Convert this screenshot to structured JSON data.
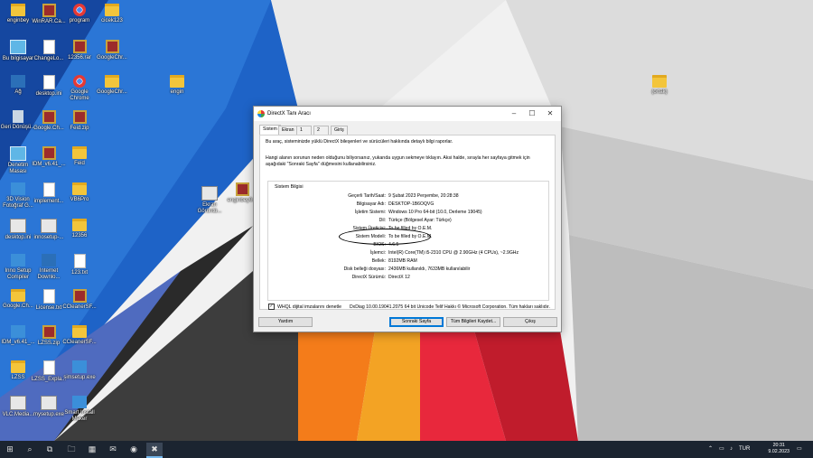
{
  "desktop": {
    "icons": [
      {
        "label": "enginbey",
        "type": "folder"
      },
      {
        "label": "WinRAR.Ca...",
        "type": "rar"
      },
      {
        "label": "program",
        "type": "chrome"
      },
      {
        "label": "cicek123",
        "type": "folder"
      },
      {
        "label": "Bu bilgisayar",
        "type": "pc"
      },
      {
        "label": "ChangeLo...",
        "type": "doc"
      },
      {
        "label": "12356.rar",
        "type": "rar"
      },
      {
        "label": "GoogleChr...",
        "type": "rar"
      },
      {
        "label": "Ağ",
        "type": "net"
      },
      {
        "label": "desktop.ini",
        "type": "doc"
      },
      {
        "label": "Google Chrome",
        "type": "chrome"
      },
      {
        "label": "GoogleChr...",
        "type": "folder"
      },
      {
        "label": "engin",
        "type": "folder"
      },
      {
        "label": "Geri Dönüşü...",
        "type": "trash"
      },
      {
        "label": "Google.Ch...",
        "type": "rar"
      },
      {
        "label": "Feid.zip",
        "type": "rar"
      },
      {
        "label": "Denetim Masası",
        "type": "pc"
      },
      {
        "label": "IDM_v6.41_...",
        "type": "rar"
      },
      {
        "label": "Feid",
        "type": "folder"
      },
      {
        "label": "3D Vision Fotoğraf G...",
        "type": "setup"
      },
      {
        "label": "implement...",
        "type": "doc"
      },
      {
        "label": "VB6Pro",
        "type": "folder"
      },
      {
        "label": "Ekran Görüntü...",
        "type": "exe"
      },
      {
        "label": "enginbey0...",
        "type": "rar"
      },
      {
        "label": "desktop.ini",
        "type": "exe"
      },
      {
        "label": "innosetup-...",
        "type": "exe"
      },
      {
        "label": "12356",
        "type": "folder"
      },
      {
        "label": "Inno Setup Compiler",
        "type": "setup"
      },
      {
        "label": "Internet Downlo...",
        "type": "net"
      },
      {
        "label": "123.txt",
        "type": "doc"
      },
      {
        "label": "Google.Ch...",
        "type": "folder"
      },
      {
        "label": "License.txt",
        "type": "doc"
      },
      {
        "label": "CCleanerSF...",
        "type": "rar"
      },
      {
        "label": "IDM_v6.41_...",
        "type": "setup"
      },
      {
        "label": "LZSS.zip",
        "type": "rar"
      },
      {
        "label": "CCleanerSF...",
        "type": "folder"
      },
      {
        "label": "LZSS",
        "type": "folder"
      },
      {
        "label": "LZSS_Expla...",
        "type": "doc"
      },
      {
        "label": "simsetup.exe",
        "type": "setup"
      },
      {
        "label": "VLC.Media...",
        "type": "exe"
      },
      {
        "label": "mysetup.exe",
        "type": "exe"
      },
      {
        "label": "Smart Install Maker",
        "type": "setup"
      },
      {
        "label": "(ortak)",
        "type": "folder"
      }
    ]
  },
  "dxdiag": {
    "title": "DirectX Tanı Aracı",
    "controls": {
      "minimize": "–",
      "maximize": "☐",
      "close": "✕"
    },
    "tabs": [
      "Sistem",
      "Ekran",
      "1 Ses",
      "2 Ses",
      "Giriş"
    ],
    "intro1": "Bu araç, sisteminizde yüklü DirectX bileşenleri ve sürücüleri hakkında detaylı bilgi raporlar.",
    "intro2": "Hangi alanın sorunun neden olduğunu biliyorsanız, yukarıda uygun sekmeye tıklayın. Aksi halde, sırayla her sayfaya gitmek için aşağıdaki \"Sonraki Sayfa\" düğmesini kullanabilirsiniz.",
    "group_title": "Sistem Bilgisi",
    "info": [
      {
        "k": "Geçerli Tarih/Saat:",
        "v": "9 Şubat 2023 Perşembe, 20:28:38"
      },
      {
        "k": "Bilgisayar Adı:",
        "v": "DESKTOP-1B6OQVG"
      },
      {
        "k": "İşletim Sistemi:",
        "v": "Windows 10 Pro 64-bit (10.0, Derleme 19045)"
      },
      {
        "k": "Dil:",
        "v": "Türkçe (Bölgesel Ayar: Türkçe)"
      },
      {
        "k": "Sistem Üreticisi:",
        "v": "To be filled by O.E.M."
      },
      {
        "k": "Sistem Modeli:",
        "v": "To be filled by O.E.M."
      },
      {
        "k": "BIOS:",
        "v": "4.6.5"
      },
      {
        "k": "İşlemci:",
        "v": "Intel(R) Core(TM) i5-2310 CPU @ 2.90GHz (4 CPUs), ~2.9GHz"
      },
      {
        "k": "Bellek:",
        "v": "8192MB RAM"
      },
      {
        "k": "Disk belleği dosyası:",
        "v": "2436MB kullanıldı, 7633MB kullanılabilir"
      },
      {
        "k": "DirectX Sürümü:",
        "v": "DirectX 12"
      }
    ],
    "whql_label": "WHQL dijital imzalarını denetle",
    "whql_checked": "✓",
    "footer": "DxDiag 10.00.19041.2075 64 bit Unicode  Telif Hakkı © Microsoft Corporation. Tüm hakları saklıdır.",
    "buttons": {
      "help": "Yardım",
      "next": "Sonraki Sayfa",
      "save": "Tüm Bilgileri Kaydet...",
      "exit": "Çıkış"
    }
  },
  "taskbar": {
    "start_icon": "⊞",
    "search_icon": "⌕",
    "taskview_icon": "⧉",
    "items": [
      "🗀",
      "▦",
      "✉",
      "◉",
      "✖"
    ],
    "tray": {
      "chevron": "⌃",
      "lang": "TUR",
      "time": "20:31",
      "date": "9.02.2023",
      "notif": "▭"
    }
  }
}
